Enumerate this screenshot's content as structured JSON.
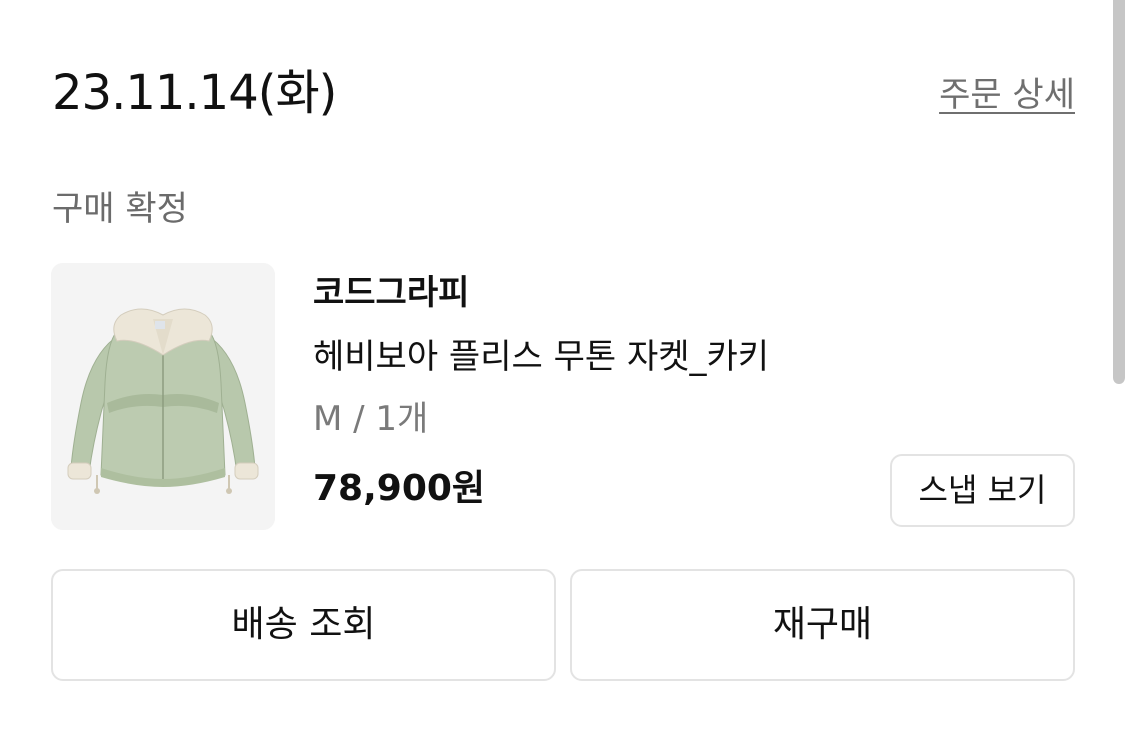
{
  "order": {
    "date": "23.11.14(화)",
    "detail_link": "주문 상세",
    "status": "구매 확정"
  },
  "product": {
    "brand": "코드그라피",
    "name": "헤비보아 플리스 무톤 자켓_카키",
    "option": "M / 1개",
    "price": "78,900원",
    "image_icon": "jacket-image",
    "colors": {
      "jacket": "#b9c9ad",
      "collar": "#ece6d8"
    }
  },
  "buttons": {
    "snap_label": "스냅 보기",
    "track_label": "배송 조회",
    "rebuy_label": "재구매"
  }
}
